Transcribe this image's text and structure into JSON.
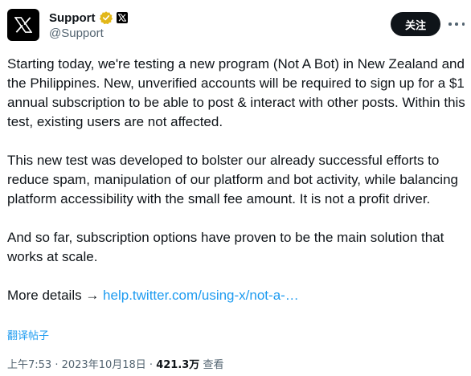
{
  "author": {
    "display_name": "Support",
    "handle": "@Support",
    "avatar_icon": "x-logo-icon",
    "verified_badge_icon": "verified-gold-badge-icon",
    "affiliate_badge_icon": "x-affiliate-badge-icon",
    "verified_color": "#e2b719"
  },
  "actions": {
    "follow_label": "关注",
    "more_icon": "more-dots-icon"
  },
  "tweet": {
    "paragraph_1": "Starting today, we're testing a new program (Not A Bot) in New Zealand and the Philippines. New, unverified accounts will be required to sign up for a $1 annual subscription to be able to post & interact with other posts. Within this test, existing users are not affected.",
    "paragraph_2": "This new test was developed to bolster our already successful efforts to reduce spam, manipulation of our platform and bot activity, while balancing platform accessibility with the small fee amount. It is not a profit driver.",
    "paragraph_3": "And so far, subscription options have proven to be the main solution that works at scale.",
    "more_details_prefix": "More details → ",
    "link_text": "help.twitter.com/using-x/not-a-…",
    "translate_label": "翻译帖子"
  },
  "meta": {
    "time": "上午7:53",
    "separator_1": " · ",
    "date": "2023年10月18日",
    "separator_2": " · ",
    "views_count": "421.3万",
    "views_label": " 查看"
  },
  "colors": {
    "text_primary": "#0f1419",
    "text_secondary": "#536471",
    "link": "#1d9bf0",
    "button_bg": "#0f1419"
  }
}
